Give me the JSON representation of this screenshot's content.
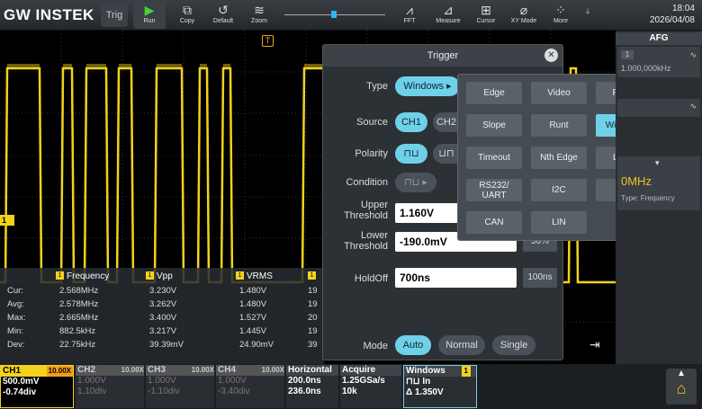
{
  "brand": "GW INSTEK",
  "toolbar": {
    "trig_label": "Trig",
    "run": "Run",
    "copy": "Copy",
    "default": "Default",
    "zoom": "Zoom",
    "fft": "FFT",
    "measure": "Measure",
    "cursor": "Cursor",
    "xymode": "XY Mode",
    "more": "More"
  },
  "clock": {
    "time": "18:04",
    "date": "2026/04/08"
  },
  "screen": {
    "trigger_marker": "T",
    "ch1_marker": "1"
  },
  "measurements": {
    "headers": [
      "Frequency",
      "Vpp",
      "VRMS"
    ],
    "rows": [
      {
        "label": "Cur:",
        "values": [
          "2.568MHz",
          "3.230V",
          "1.480V"
        ],
        "extra": "19"
      },
      {
        "label": "Avg:",
        "values": [
          "2.578MHz",
          "3.262V",
          "1.480V"
        ],
        "extra": "19"
      },
      {
        "label": "Max:",
        "values": [
          "2.665MHz",
          "3.400V",
          "1.527V"
        ],
        "extra": "20"
      },
      {
        "label": "Min:",
        "values": [
          "882.5kHz",
          "3.217V",
          "1.445V"
        ],
        "extra": "19"
      },
      {
        "label": "Dev:",
        "values": [
          "22.75kHz",
          "39.39mV",
          "24.90mV"
        ],
        "extra": "39"
      }
    ]
  },
  "trigger_dialog": {
    "title": "Trigger",
    "type_label": "Type",
    "type_value": "Windows",
    "source_label": "Source",
    "source_ch1": "CH1",
    "source_ch2": "CH2",
    "polarity_label": "Polarity",
    "condition_label": "Condition",
    "upper_label": "Upper Threshold",
    "upper_value": "1.160V",
    "lower_label": "Lower Threshold",
    "lower_value": "-190.0mV",
    "lower_pct": "50%",
    "holdoff_label": "HoldOff",
    "holdoff_value": "700ns",
    "holdoff_unit": "100ns",
    "mode_label": "Mode",
    "mode_auto": "Auto",
    "mode_normal": "Normal",
    "mode_single": "Single"
  },
  "trigger_types": [
    {
      "label": "Edge",
      "selected": false
    },
    {
      "label": "Video",
      "selected": false
    },
    {
      "label": "Pulse",
      "selected": false
    },
    {
      "label": "Slope",
      "selected": false
    },
    {
      "label": "Runt",
      "selected": false
    },
    {
      "label": "Windows",
      "selected": true
    },
    {
      "label": "Timeout",
      "selected": false
    },
    {
      "label": "Nth Edge",
      "selected": false
    },
    {
      "label": "Logic",
      "selected": false
    },
    {
      "label": "RS232/ UART",
      "selected": false
    },
    {
      "label": "I2C",
      "selected": false
    },
    {
      "label": "SPI",
      "selected": false
    },
    {
      "label": "CAN",
      "selected": false
    },
    {
      "label": "LIN",
      "selected": false
    }
  ],
  "side": {
    "afg": "AFG",
    "afg_ch": "1",
    "afg_freq": "1.000,000kHz",
    "freq_partial": "0MHz",
    "freq_type": "Type: Frequency"
  },
  "bottom": {
    "ch1": {
      "name": "CH1",
      "bw": "10.00X",
      "scale": "500.0mV",
      "offset": "-0.74div"
    },
    "ch2": {
      "name": "CH2",
      "bw": "10.00X",
      "scale": "1.000V",
      "offset": "1.10div"
    },
    "ch3": {
      "name": "CH3",
      "bw": "10.00X",
      "scale": "1.000V",
      "offset": "-1.10div"
    },
    "ch4": {
      "name": "CH4",
      "bw": "10.00X",
      "scale": "1.000V",
      "offset": "-3.40div"
    },
    "horizontal": {
      "name": "Horizontal",
      "scale": "200.0ns",
      "position": "236.0ns"
    },
    "acquire": {
      "name": "Acquire",
      "rate": "1.25GSa/s",
      "length": "10k"
    },
    "trigger": {
      "name": "Windows",
      "ch": "1",
      "cond": "In",
      "delta": "Δ 1.350V"
    }
  },
  "colors": {
    "ch1": "#f2d21c",
    "accent": "#6fd1e8"
  }
}
